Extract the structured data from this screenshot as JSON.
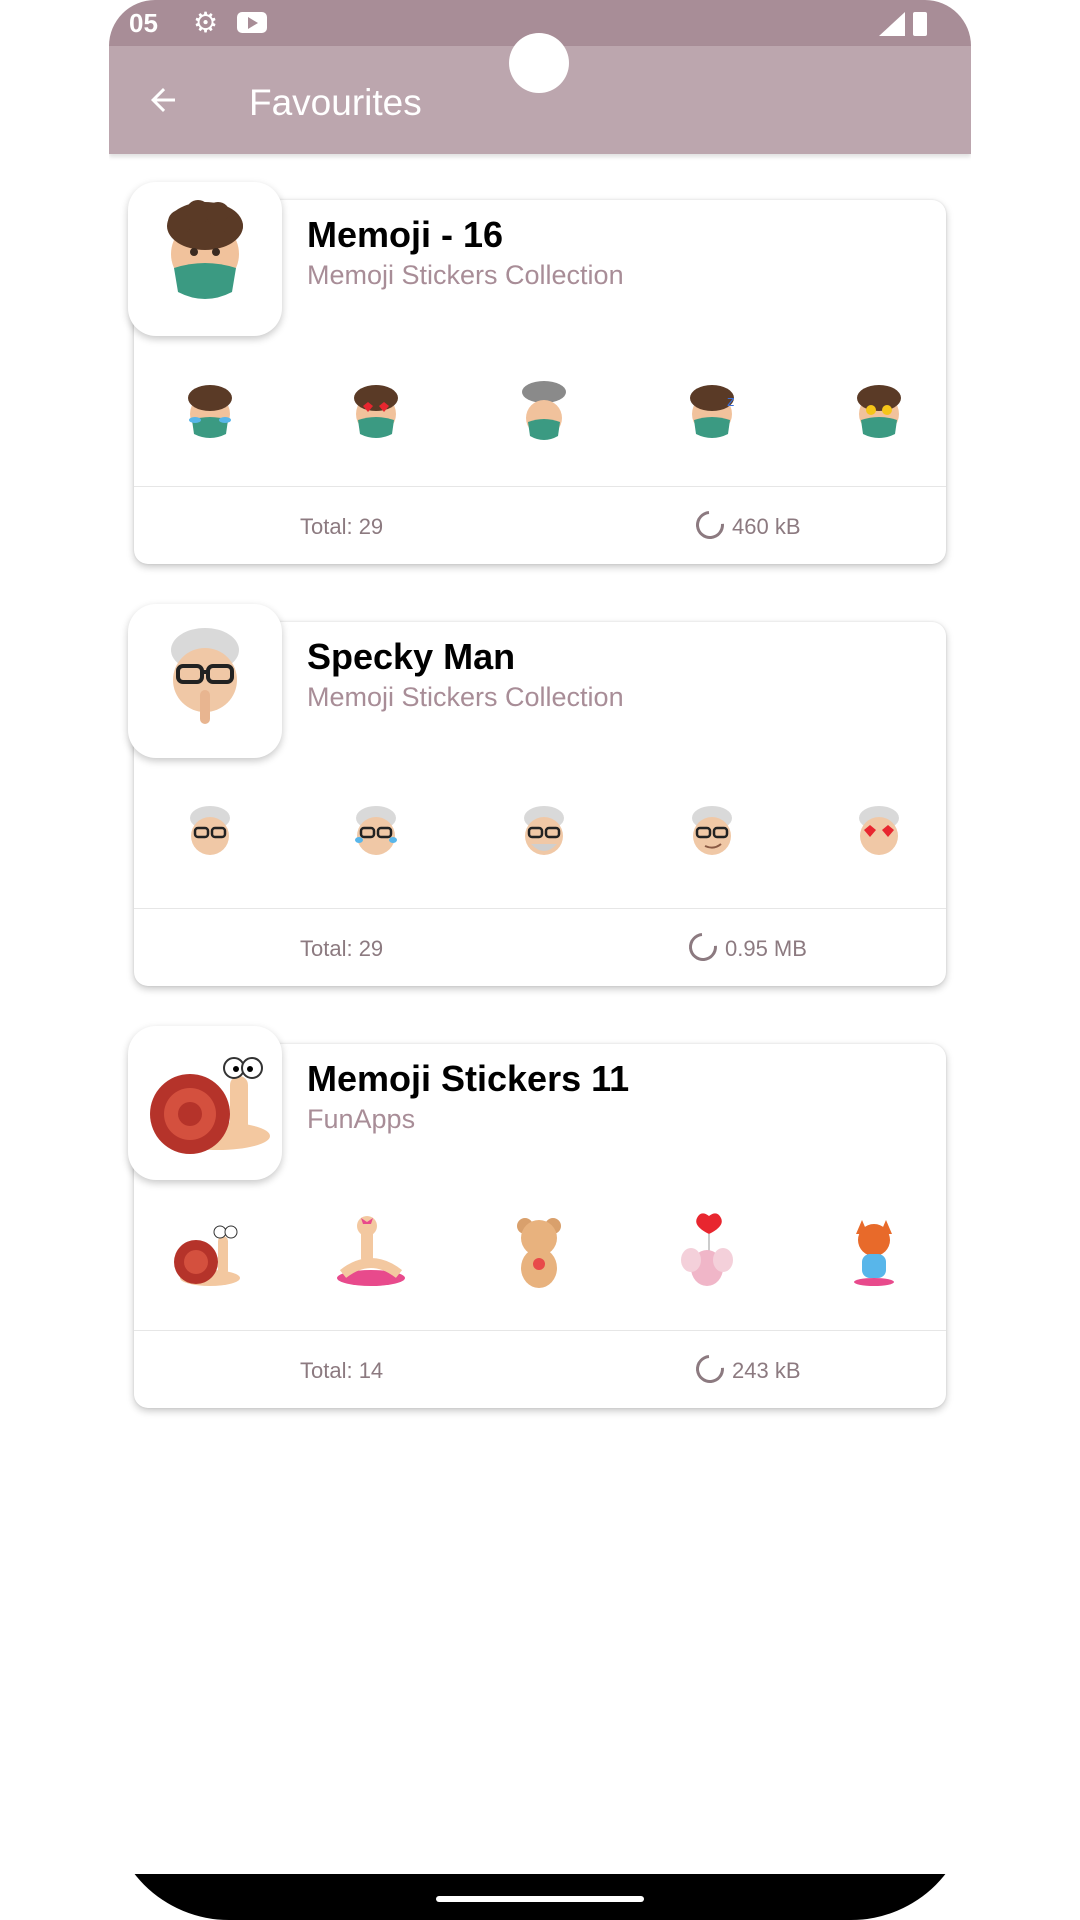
{
  "status_bar": {
    "time": "05"
  },
  "app_bar": {
    "title": "Favourites"
  },
  "packs": [
    {
      "title": "Memoji - 16",
      "subtitle": "Memoji Stickers Collection",
      "total": "Total: 29",
      "size": "460 kB"
    },
    {
      "title": "Specky Man",
      "subtitle": "Memoji Stickers Collection",
      "total": "Total: 29",
      "size": "0.95 MB"
    },
    {
      "title": "Memoji Stickers 11",
      "subtitle": "FunApps",
      "total": "Total: 14",
      "size": "243 kB"
    }
  ],
  "colors": {
    "status_bar": "#a88d97",
    "app_bar": "#bca6ae",
    "accent_text": "#a88d97",
    "meta_text": "#8c7a80"
  }
}
